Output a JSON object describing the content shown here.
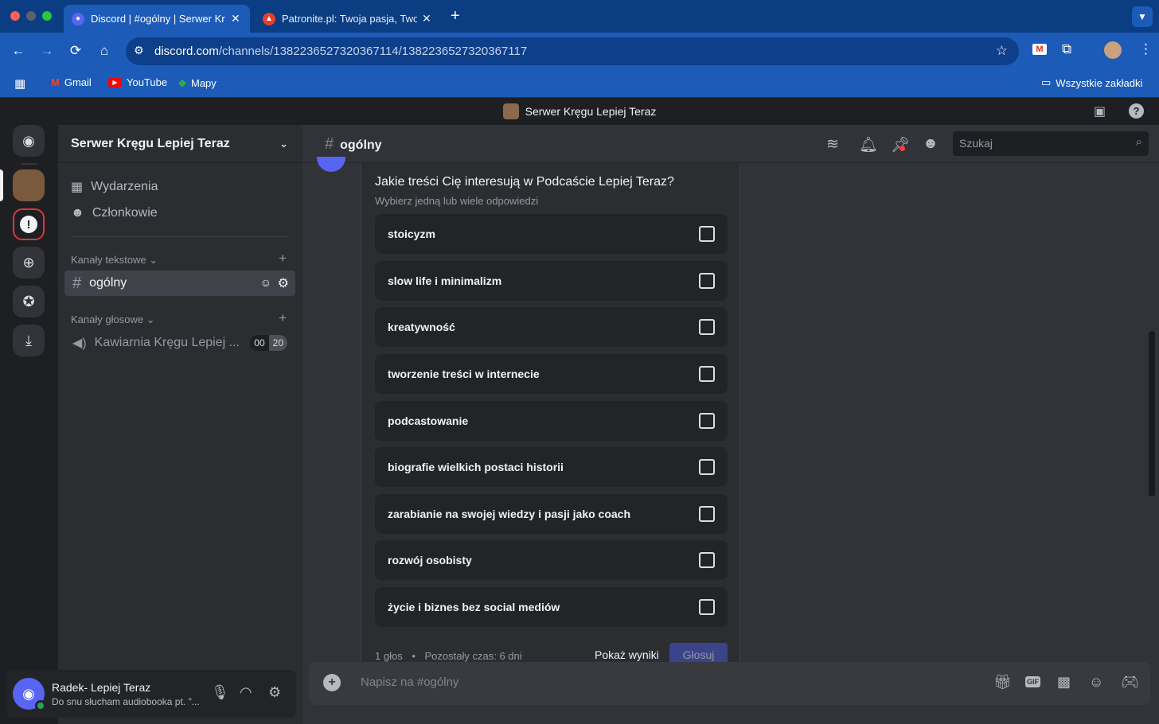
{
  "browser": {
    "tabs": [
      {
        "title": "Discord | #ogólny | Serwer Kr",
        "active": true
      },
      {
        "title": "Patronite.pl: Twoja pasja, Two",
        "active": false
      }
    ],
    "url_host": "discord.com",
    "url_path": "/channels/1382236527320367114/1382236527320367117",
    "bookmarks": [
      "Gmail",
      "YouTube",
      "Mapy"
    ],
    "all_bookmarks": "Wszystkie zakładki"
  },
  "app": {
    "window_title": "Serwer Kręgu Lepiej Teraz"
  },
  "sidebar": {
    "server_name": "Serwer Kręgu Lepiej Teraz",
    "items": [
      "Wydarzenia",
      "Członkowie"
    ],
    "text_category": "Kanały tekstowe",
    "text_channel": "ogólny",
    "voice_category": "Kanały głosowe",
    "voice_channel": "Kawiarnia Kręgu Lepiej ...",
    "voice_badge": [
      "00",
      "20"
    ]
  },
  "user": {
    "name": "Radek- Lepiej Teraz",
    "status": "Do snu słucham audiobooka pt. \"..."
  },
  "channel_header": {
    "name": "ogólny",
    "search_placeholder": "Szukaj"
  },
  "poll": {
    "question": "Jakie treści Cię interesują w Podcaście Lepiej Teraz?",
    "subtitle": "Wybierz jedną lub wiele odpowiedzi",
    "options": [
      "stoicyzm",
      "slow life i minimalizm",
      "kreatywność",
      "tworzenie treści w internecie",
      "podcastowanie",
      "biografie wielkich postaci historii",
      "zarabianie na swojej wiedzy i pasji jako coach",
      "rozwój osobisty",
      "życie i biznes bez social mediów"
    ],
    "votes": "1 głos",
    "separator": "•",
    "time_left": "Pozostały czas: 6 dni",
    "show_results": "Pokaż wyniki",
    "vote_button": "Głosuj"
  },
  "composer": {
    "placeholder": "Napisz na #ogólny",
    "gif": "GIF"
  },
  "colors": {
    "blurple": "#5865f2",
    "online": "#23a55a",
    "browser_blue": "#1c5bb8"
  }
}
